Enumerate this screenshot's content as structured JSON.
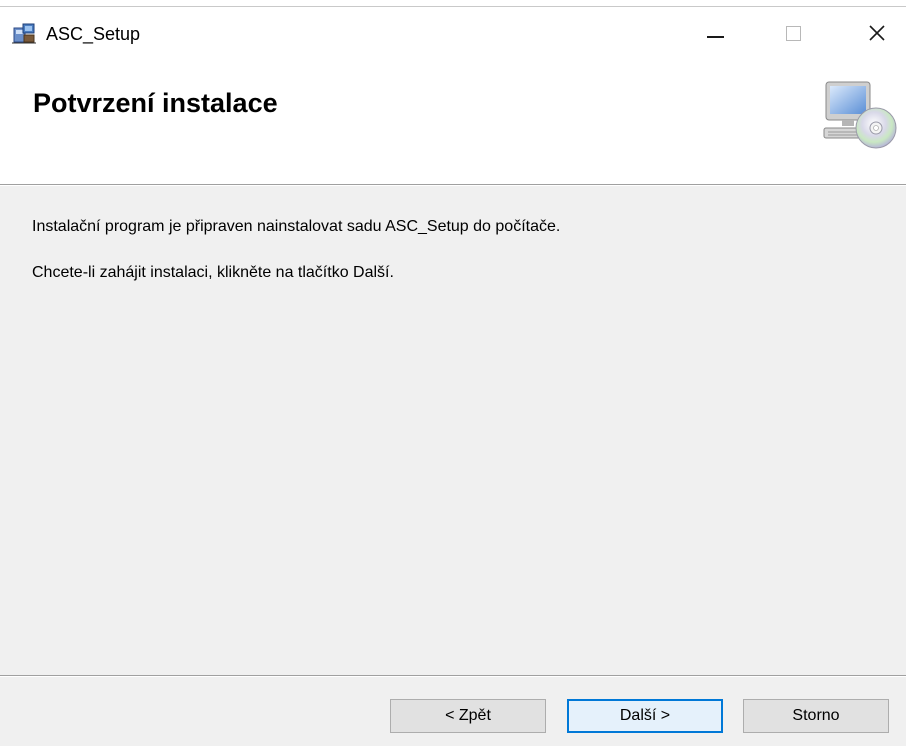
{
  "window": {
    "title": "ASC_Setup",
    "icon": "installer-package-icon",
    "controls": [
      "minimize-icon",
      "maximize-icon",
      "close-icon"
    ]
  },
  "header": {
    "title": "Potvrzení instalace",
    "icon": "computer-cd-icon"
  },
  "content": {
    "line1": "Instalační program je připraven nainstalovat sadu ASC_Setup do počítače.",
    "line2": "Chcete-li zahájit instalaci, klikněte na tlačítko Další."
  },
  "buttons": {
    "back": "< Zpět",
    "next": "Další >",
    "cancel": "Storno"
  },
  "colors": {
    "dialog_background": "#f0f0f0",
    "header_background": "#ffffff",
    "default_button_border": "#0078d7"
  }
}
